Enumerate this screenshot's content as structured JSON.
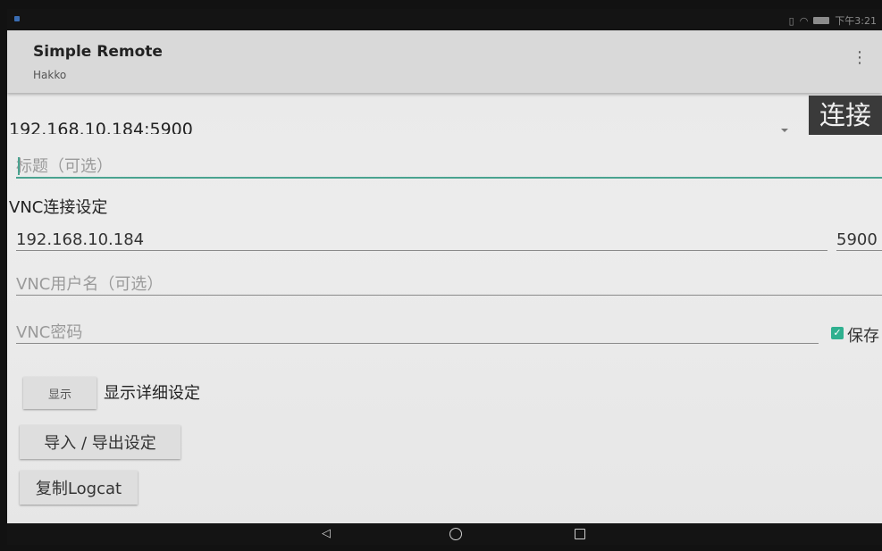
{
  "status_bar": {
    "time": "下午3:21",
    "icons": [
      "vibrate-icon",
      "wifi-icon",
      "battery-icon"
    ]
  },
  "app_bar": {
    "title": "Simple Remote",
    "subtitle": "Hakko",
    "overflow_icon": "⋮"
  },
  "connection": {
    "selected": "192.168.10.184:5900",
    "connect_label": "连接"
  },
  "title_field": {
    "placeholder": "标题（可选）",
    "value": ""
  },
  "vnc": {
    "section_label": "VNC连接设定",
    "host_value": "192.168.10.184",
    "port_value": "5900",
    "username_placeholder": "VNC用户名（可选）",
    "password_placeholder": "VNC密码",
    "save_label": "保存",
    "save_checked": true
  },
  "details": {
    "show_button_label": "显示",
    "show_details_label": "显示详细设定"
  },
  "actions": {
    "import_export_label": "导入 / 导出设定",
    "copy_logcat_label": "复制Logcat"
  },
  "nav_bar": {
    "back_icon": "◁",
    "home_icon": "circle",
    "recent_icon": "square"
  },
  "colors": {
    "accent": "#4aa390",
    "checkbox": "#2fb08f",
    "connect_button_bg": "#3a3a3a",
    "app_bar_bg": "#d9d9d9"
  }
}
